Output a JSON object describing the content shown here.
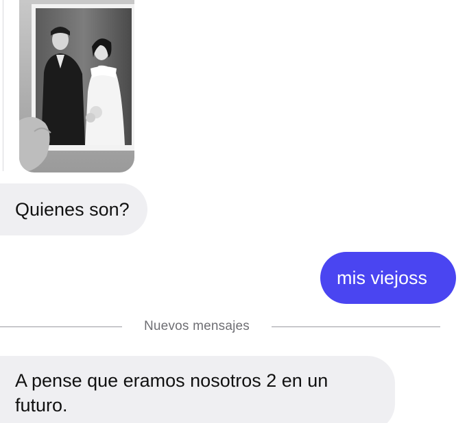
{
  "conversation": {
    "messages": [
      {
        "from": "them",
        "type": "image",
        "alt": ""
      },
      {
        "from": "them",
        "type": "text",
        "text": "Quienes son?"
      },
      {
        "from": "me",
        "type": "text",
        "text": "mis viejoss"
      }
    ],
    "divider_label": "Nuevos mensajes",
    "new_messages": [
      {
        "from": "them",
        "type": "text",
        "text": "A pense que eramos nosotros 2 en un futuro."
      }
    ]
  },
  "colors": {
    "outgoing_bubble": "#4a45f1",
    "incoming_bubble": "#efeff2",
    "divider": "#9a9aa0"
  }
}
